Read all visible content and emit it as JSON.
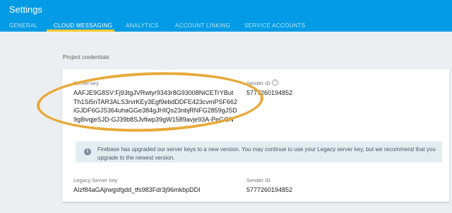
{
  "header": {
    "title": "Settings",
    "tabs": [
      {
        "label": "GENERAL",
        "active": false
      },
      {
        "label": "CLOUD MESSAGING",
        "active": true
      },
      {
        "label": "ANALYTICS",
        "active": false
      },
      {
        "label": "ACCOUNT LINKING",
        "active": false
      },
      {
        "label": "SERVICE ACCOUNTS",
        "active": false
      }
    ]
  },
  "project_credentials": {
    "section_label": "Project credentials",
    "server_key_label": "Server key",
    "server_key_lines": [
      "AAFJE9G8SV:Fj93tgJVRwtyr9343r8G93008NiCETrYBut",
      "Th1Si5nTAR3ALS3rvrKEy3Egf9ebdDDFE423cvmPSF662",
      "iGJDF6GJS364uhaGGe384gJHIQs23nbjRNFG2859gJSD",
      "9g8ivqjeSJD-GJ39b8SJvfiwp39gW1589avje93A-PeGGN"
    ],
    "sender_id_label": "Sender ID",
    "sender_id_value": "5777260194852",
    "help_icon_glyph": "?",
    "info_icon_glyph": "i",
    "info_text": "Firebase has upgraded our server keys to a new version. You may continue to use your Legacy server key, but we recommend that you upgrade to the newest version.",
    "legacy_server_key_label": "Legacy Server key",
    "legacy_server_key_value": "AIzf84aGAjrwgsfgdd_tfs983Fdr3j96mkbpDDI",
    "legacy_sender_id_label": "Sender ID",
    "legacy_sender_id_value": "5777260194852"
  },
  "colors": {
    "header_bg": "#039be5",
    "active_tab_underline": "#ffca28",
    "highlight_ellipse": "#e8a93a"
  }
}
